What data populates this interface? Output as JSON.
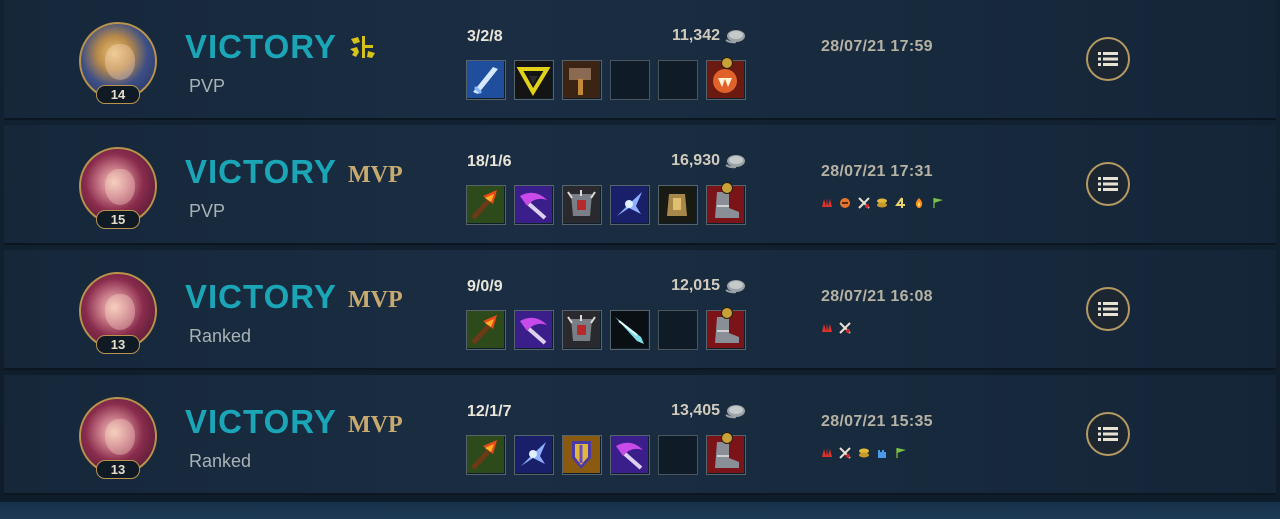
{
  "matches": [
    {
      "champion_level": "14",
      "champion_icon": "ezreal-portrait",
      "result": "VICTORY",
      "badge": "first-blood-icon",
      "badge_text": "",
      "mode": "PVP",
      "kda": "3/2/8",
      "gold": "11,342",
      "datetime": "28/07/21  17:59",
      "items": [
        "item-blue-blade",
        "item-gold-triangle",
        "item-hammer",
        "",
        "",
        "item-red-fang"
      ],
      "item_pips": [
        false,
        false,
        false,
        false,
        false,
        true
      ],
      "achievements": []
    },
    {
      "champion_level": "15",
      "champion_icon": "vi-portrait",
      "result": "VICTORY",
      "badge": "",
      "badge_text": "MVP",
      "mode": "PVP",
      "kda": "18/1/6",
      "gold": "16,930",
      "datetime": "28/07/21  17:31",
      "items": [
        "item-fire-axe",
        "item-purple-scythe",
        "item-spiked-armor",
        "item-blue-shuriken",
        "item-gold-hand",
        "item-red-boots"
      ],
      "item_pips": [
        false,
        false,
        false,
        false,
        false,
        true
      ],
      "achievements": [
        "red-claw-icon",
        "orange-horn-icon",
        "crossed-swords-icon",
        "coins-icon",
        "number-4-icon",
        "fire-icon",
        "green-flag-icon"
      ]
    },
    {
      "champion_level": "13",
      "champion_icon": "vi-portrait",
      "result": "VICTORY",
      "badge": "",
      "badge_text": "MVP",
      "mode": "Ranked",
      "kda": "9/0/9",
      "gold": "12,015",
      "datetime": "28/07/21  16:08",
      "items": [
        "item-fire-axe",
        "item-purple-scythe",
        "item-spiked-armor",
        "item-ice-blade",
        "",
        "item-red-boots"
      ],
      "item_pips": [
        false,
        false,
        false,
        false,
        false,
        true
      ],
      "achievements": [
        "red-claw-icon",
        "crossed-swords-icon"
      ]
    },
    {
      "champion_level": "13",
      "champion_icon": "vi-portrait",
      "result": "VICTORY",
      "badge": "",
      "badge_text": "MVP",
      "mode": "Ranked",
      "kda": "12/1/7",
      "gold": "13,405",
      "datetime": "28/07/21  15:35",
      "items": [
        "item-fire-axe",
        "item-blue-shuriken",
        "item-gold-shield",
        "item-purple-scythe",
        "",
        "item-red-boots"
      ],
      "item_pips": [
        false,
        false,
        false,
        false,
        false,
        true
      ],
      "achievements": [
        "red-claw-icon",
        "crossed-swords-icon",
        "coins-icon",
        "blue-tower-icon",
        "green-flag-icon"
      ]
    }
  ],
  "colors": {
    "victory": "#1ba6b7",
    "mvp": "#c8aa6e",
    "gold_border": "#b8934b"
  }
}
